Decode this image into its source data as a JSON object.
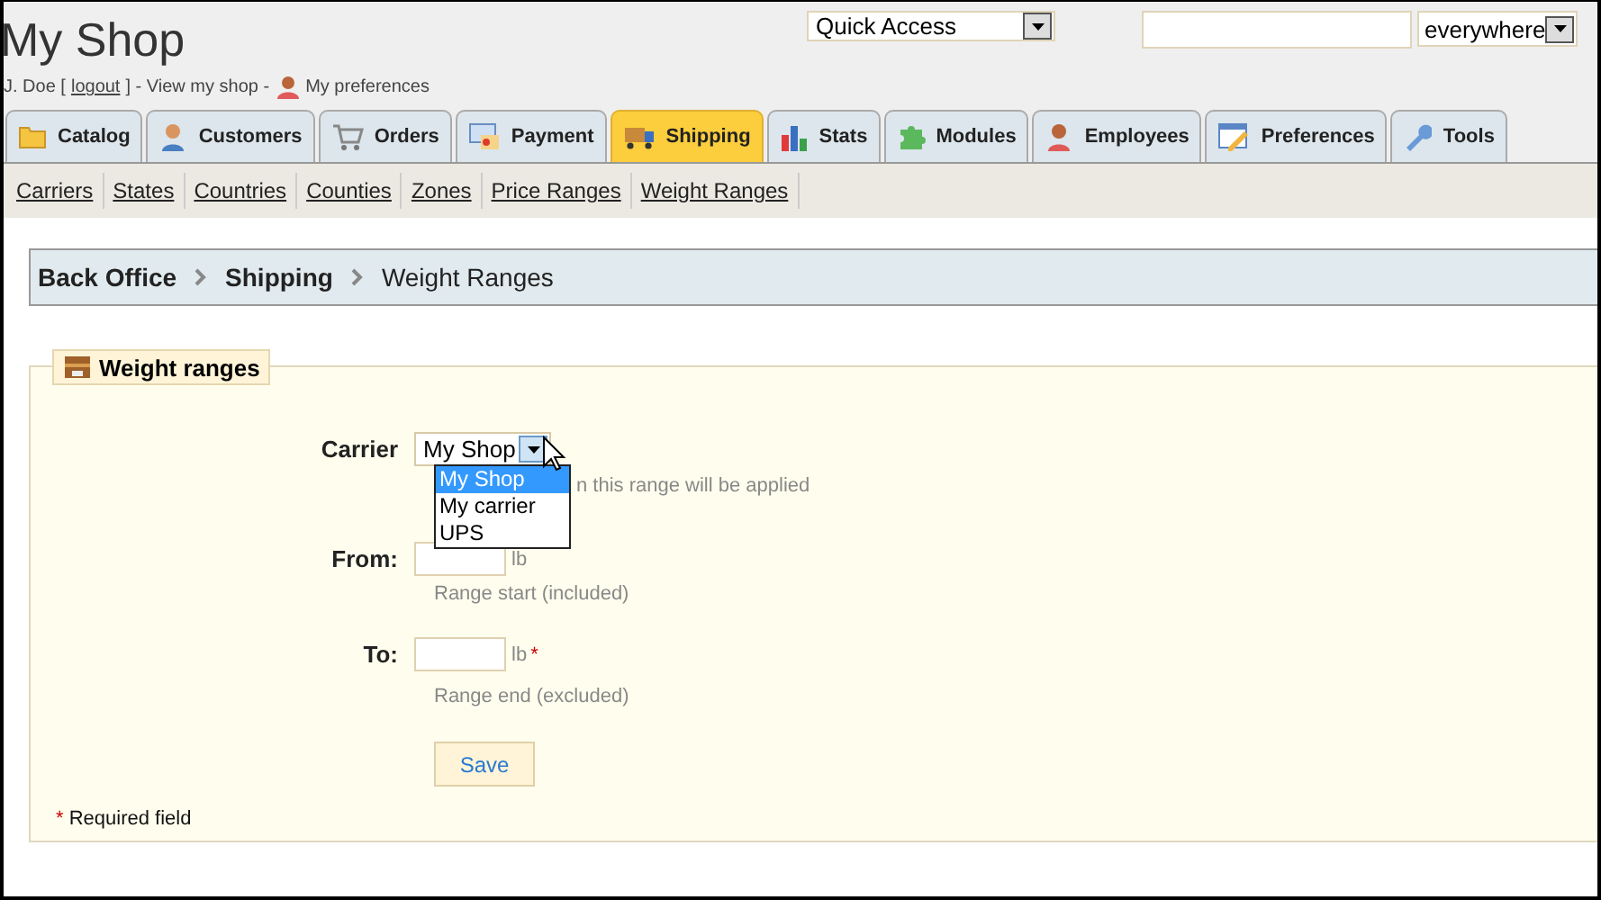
{
  "header": {
    "title": "My Shop",
    "user": "J. Doe [",
    "logout": "logout",
    "after_logout": "] - View my shop -",
    "preferences": "My preferences",
    "quick_access": "Quick Access",
    "search": {
      "scope": "everywhere"
    }
  },
  "tabs": [
    {
      "label": "Catalog",
      "selected": false
    },
    {
      "label": "Customers",
      "selected": false
    },
    {
      "label": "Orders",
      "selected": false
    },
    {
      "label": "Payment",
      "selected": false
    },
    {
      "label": "Shipping",
      "selected": true
    },
    {
      "label": "Stats",
      "selected": false
    },
    {
      "label": "Modules",
      "selected": false
    },
    {
      "label": "Employees",
      "selected": false
    },
    {
      "label": "Preferences",
      "selected": false
    },
    {
      "label": "Tools",
      "selected": false
    }
  ],
  "subnav": [
    "Carriers",
    "States",
    "Countries",
    "Counties",
    "Zones",
    "Price Ranges",
    "Weight Ranges"
  ],
  "breadcrumb": [
    {
      "label": "Back Office",
      "bold": true
    },
    {
      "label": "Shipping",
      "bold": true
    },
    {
      "label": "Weight Ranges",
      "bold": false
    }
  ],
  "form": {
    "legend": "Weight ranges",
    "carrier": {
      "label": "Carrier",
      "value": "My Shop",
      "hint": "n this range will be applied",
      "options": [
        {
          "label": "My Shop",
          "selected": true
        },
        {
          "label": "My carrier",
          "selected": false
        },
        {
          "label": "UPS",
          "selected": false
        }
      ]
    },
    "from": {
      "label": "From:",
      "unit": "lb",
      "hint": "Range start (included)"
    },
    "to": {
      "label": "To:",
      "unit": "lb",
      "required_mark": "*",
      "hint": "Range end (excluded)"
    },
    "save": "Save",
    "required_note_mark": "*",
    "required_note": "Required field"
  }
}
